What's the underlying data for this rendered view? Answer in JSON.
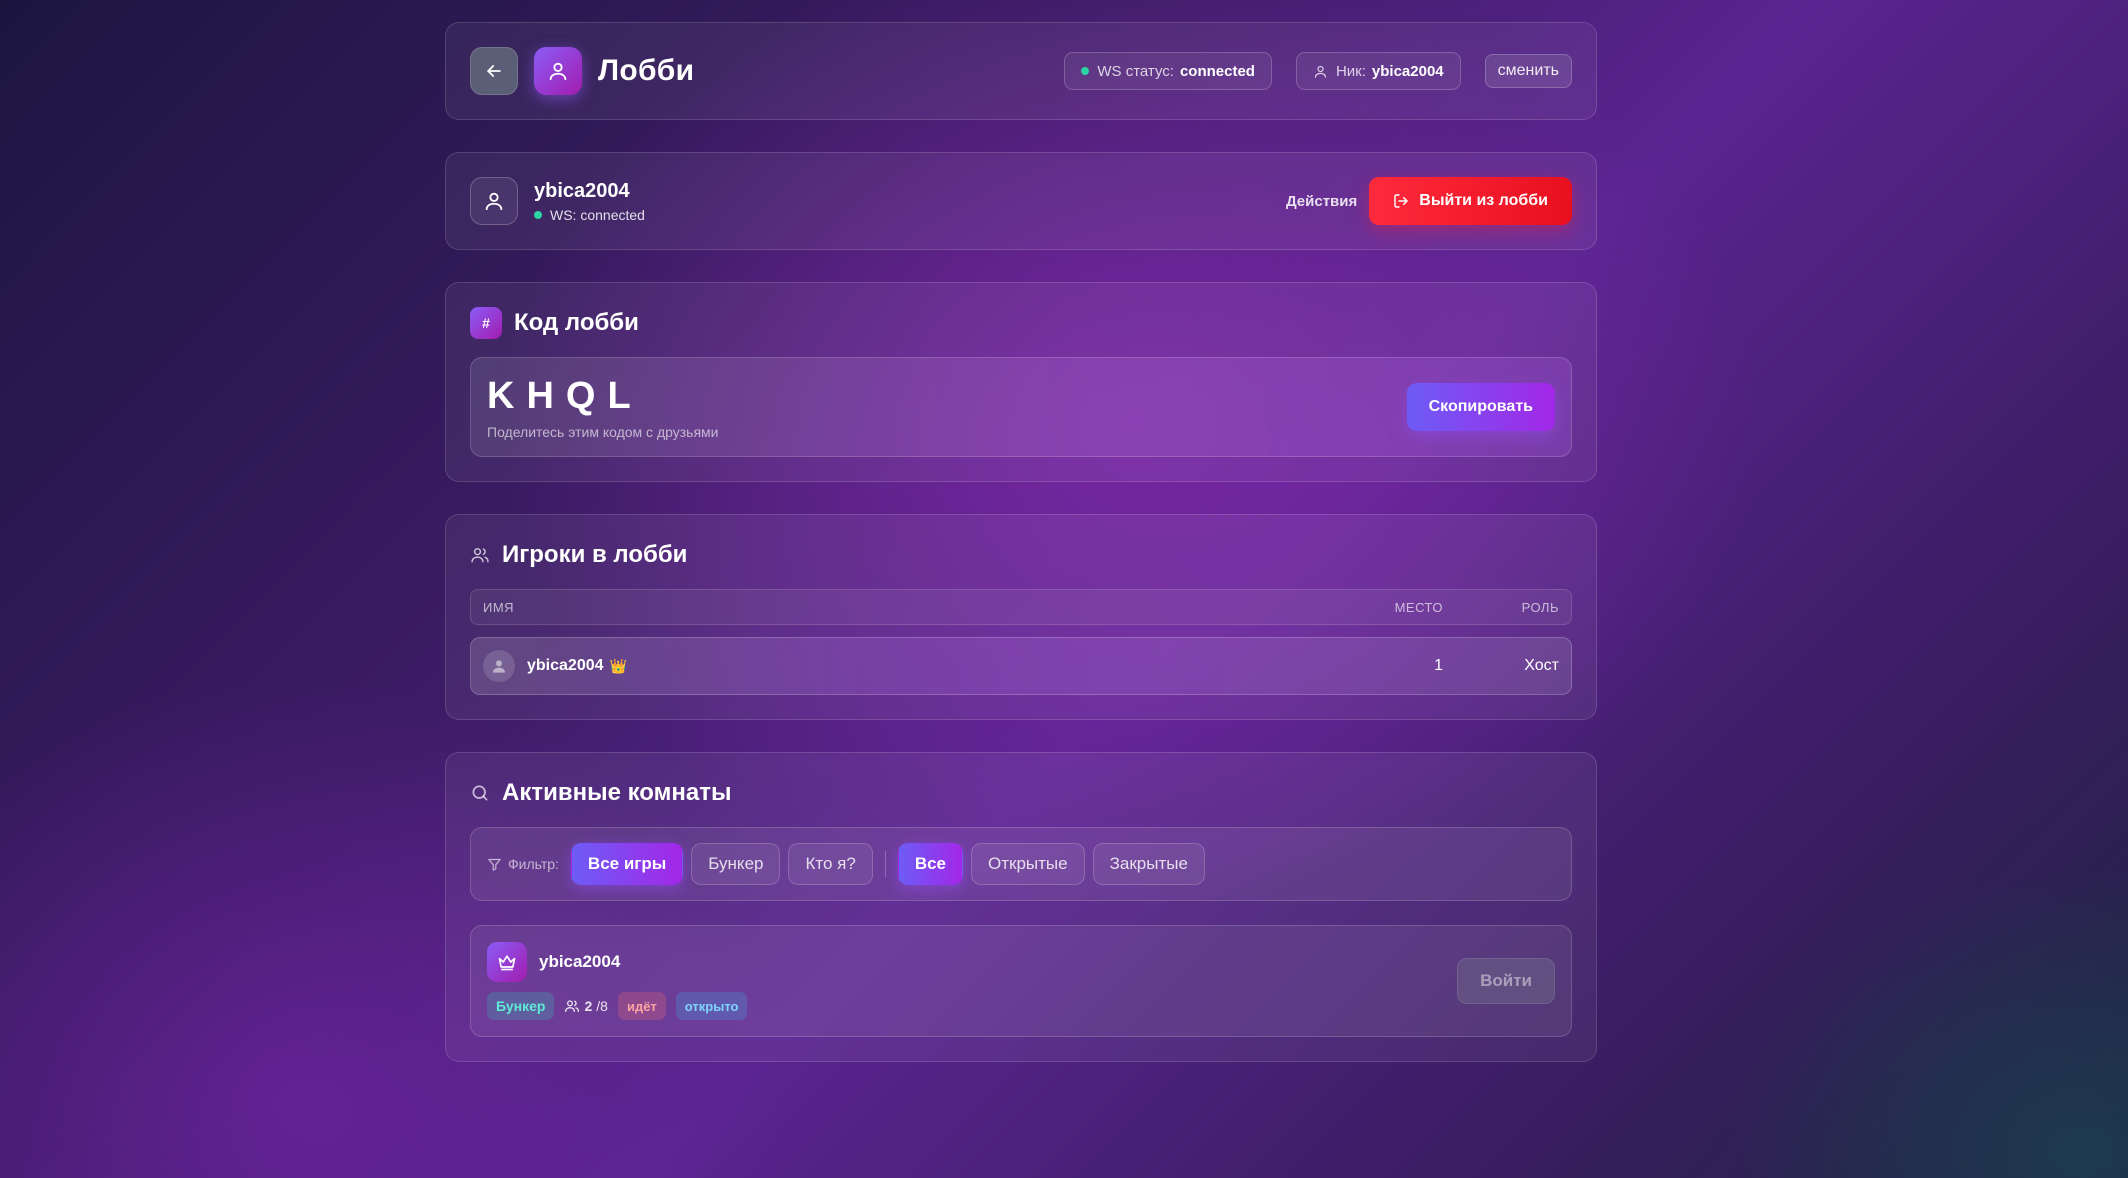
{
  "header": {
    "title": "Лобби",
    "ws_label": "WS статус:",
    "ws_value": "connected",
    "nick_label": "Ник:",
    "nick_value": "ybica2004",
    "change_label": "сменить"
  },
  "user": {
    "name": "ybica2004",
    "status": "WS: connected",
    "actions_label": "Действия",
    "leave_label": "Выйти из лобби"
  },
  "code_section": {
    "badge": "#",
    "title": "Код лобби",
    "code": "KHQL",
    "hint": "Поделитесь этим кодом с друзьями",
    "copy_label": "Скопировать"
  },
  "players_section": {
    "title": "Игроки в лобби",
    "columns": [
      "Имя",
      "Место",
      "Роль"
    ],
    "rows": [
      {
        "name": "ybica2004",
        "crown": "👑",
        "place": "1",
        "role": "Хост"
      }
    ]
  },
  "rooms_section": {
    "title": "Активные комнаты",
    "filter_label": "Фильтр:",
    "game_filters": [
      "Все игры",
      "Бункер",
      "Кто я?"
    ],
    "status_filters": [
      "Все",
      "Открытые",
      "Закрытые"
    ],
    "active_game_filter": "Все игры",
    "active_status_filter": "Все",
    "rooms": [
      {
        "host": "ybica2004",
        "game": "Бункер",
        "players": "2",
        "players_max": "/8",
        "state": "идёт",
        "access": "открыто",
        "join_label": "Войти"
      }
    ]
  },
  "colors": {
    "accent_purple": "#8b5cf6",
    "danger_red": "#ff2a3c",
    "status_green": "#2dd4a4"
  }
}
